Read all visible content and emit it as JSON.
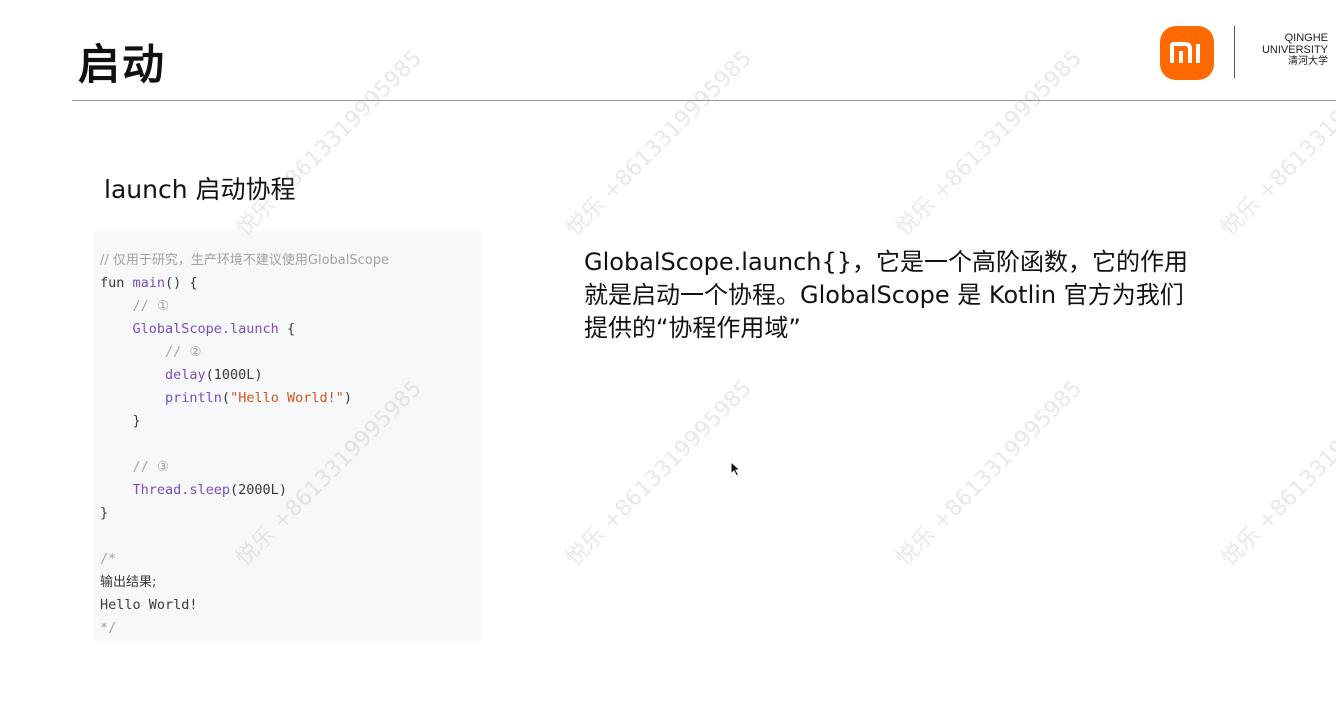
{
  "slide": {
    "title": "启动",
    "section_heading": "launch 启动协程"
  },
  "branding": {
    "logo_text": "mi",
    "logo_color": "#ff6900",
    "university_en_1": "QINGHE",
    "university_en_2": "UNIVERSITY",
    "university_cn": "清河大学"
  },
  "code": {
    "line1": "// 仅用于研究，生产环境不建议使用GlobalScope",
    "line2_kw": "fun ",
    "line2_fn": "main",
    "line2_rest": "() {",
    "line3": "    // ①",
    "line4_fn": "    GlobalScope.launch",
    "line4_rest": " {",
    "line5": "        // ②",
    "line6_fn": "        delay",
    "line6_rest": "(1000L)",
    "line7_fn": "        println",
    "line7_open": "(",
    "line7_str": "\"Hello World!\"",
    "line7_close": ")",
    "line8": "    }",
    "line10": "    // ③",
    "line11_fn": "    Thread.sleep",
    "line11_rest": "(2000L)",
    "line12": "}",
    "line14": "/*",
    "line15": "输出结果;",
    "line16": "Hello World!",
    "line17": "*/"
  },
  "description": {
    "text": "GlobalScope.launch{}，它是一个高阶函数，它的作用就是启动一个协程。GlobalScope 是 Kotlin 官方为我们提供的“协程作用域”"
  },
  "watermark": {
    "text": "悦乐 +8613319995985"
  }
}
